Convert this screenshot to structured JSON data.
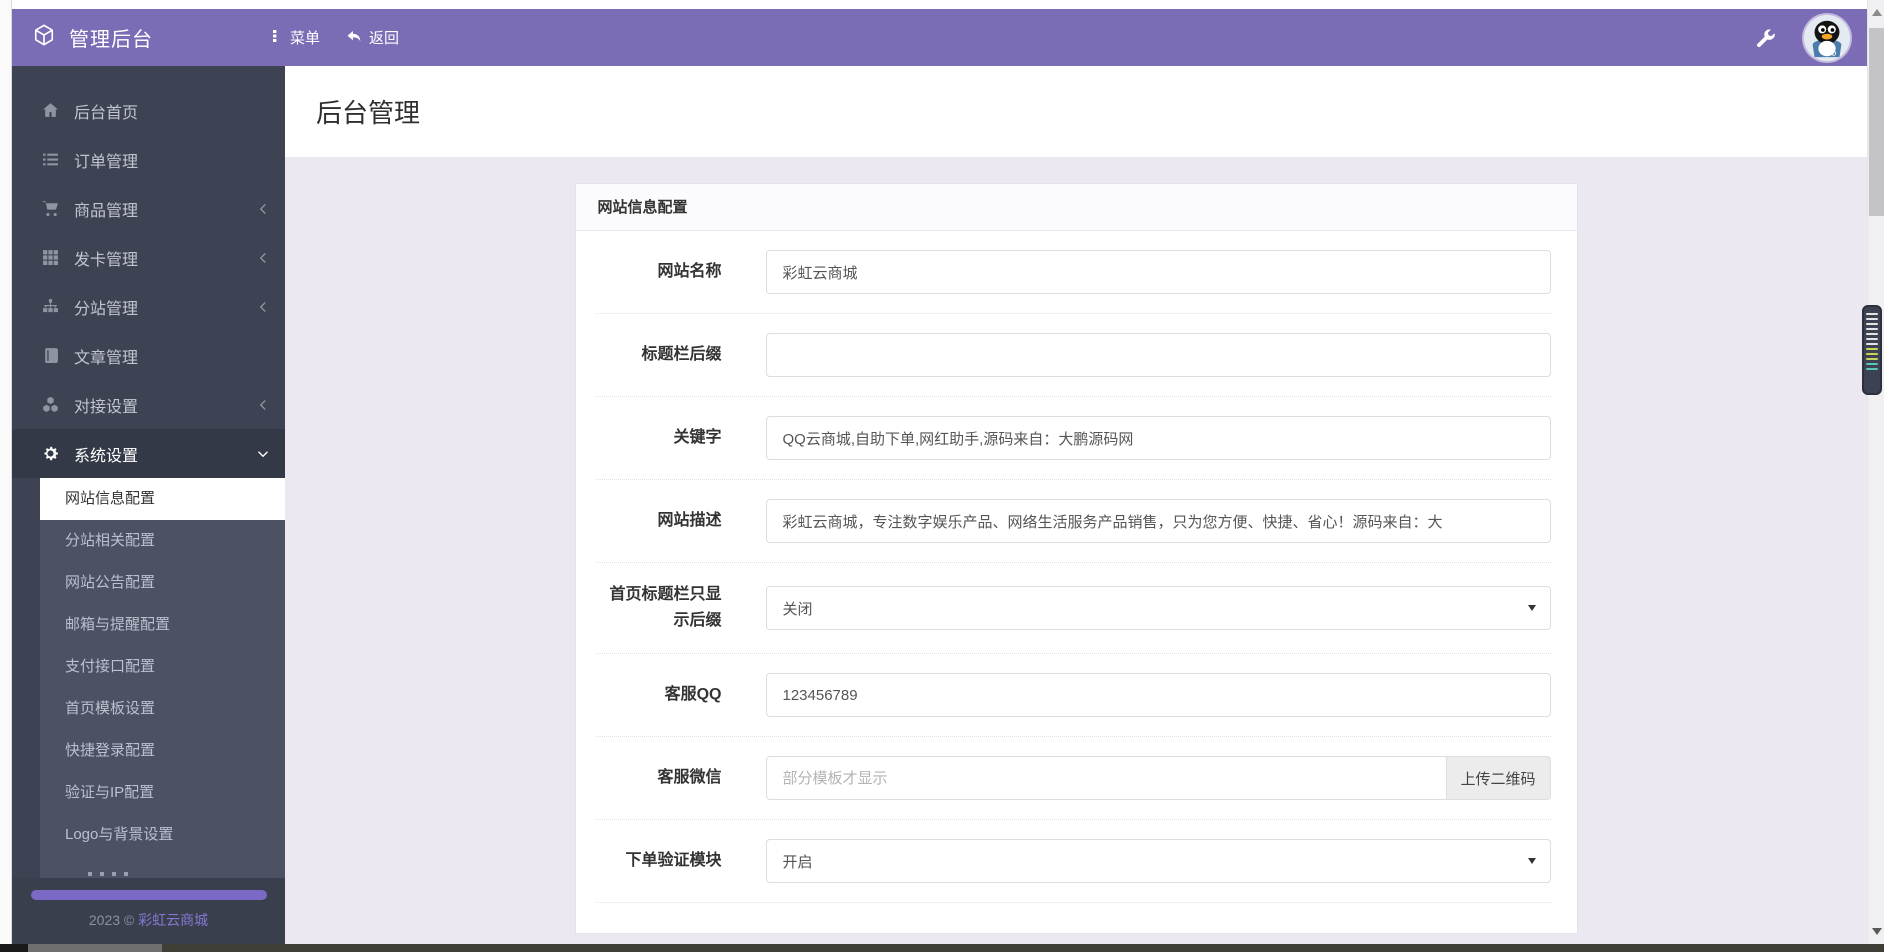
{
  "header": {
    "brand": "管理后台",
    "menu_label": "菜单",
    "back_label": "返回",
    "brand_icon": "cube-icon",
    "right_icons": [
      "wrench-icon",
      "qq-avatar"
    ]
  },
  "sidebar": {
    "items": [
      {
        "label": "后台首页",
        "icon": "home-icon",
        "chevron": null,
        "active": false
      },
      {
        "label": "订单管理",
        "icon": "list-icon",
        "chevron": null,
        "active": false
      },
      {
        "label": "商品管理",
        "icon": "cart-icon",
        "chevron": "left",
        "active": false
      },
      {
        "label": "发卡管理",
        "icon": "grid-icon",
        "chevron": "left",
        "active": false
      },
      {
        "label": "分站管理",
        "icon": "sitemap-icon",
        "chevron": "left",
        "active": false
      },
      {
        "label": "文章管理",
        "icon": "book-icon",
        "chevron": null,
        "active": false
      },
      {
        "label": "对接设置",
        "icon": "cubes-icon",
        "chevron": "left",
        "active": false
      },
      {
        "label": "系统设置",
        "icon": "gear-icon",
        "chevron": "down",
        "active": true
      }
    ],
    "submenu": [
      "网站信息配置",
      "分站相关配置",
      "网站公告配置",
      "邮箱与提醒配置",
      "支付接口配置",
      "首页模板设置",
      "快捷登录配置",
      "验证与IP配置",
      "Logo与背景设置"
    ],
    "submenu_active": "网站信息配置",
    "footer_year": "2023 © ",
    "footer_link": "彩虹云商城"
  },
  "page": {
    "title": "后台管理"
  },
  "panel": {
    "title": "网站信息配置",
    "rows": [
      {
        "label": "网站名称",
        "type": "input",
        "value": "彩虹云商城",
        "placeholder": ""
      },
      {
        "label": "标题栏后缀",
        "type": "input",
        "value": "",
        "placeholder": ""
      },
      {
        "label": "关键字",
        "type": "input",
        "value": "QQ云商城,自助下单,网红助手,源码来自：大鹏源码网",
        "placeholder": ""
      },
      {
        "label": "网站描述",
        "type": "input",
        "value": "彩虹云商城，专注数字娱乐产品、网络生活服务产品销售，只为您方便、快捷、省心！源码来自：大",
        "placeholder": ""
      },
      {
        "label": "首页标题栏只显示后缀",
        "type": "select",
        "value": "关闭"
      },
      {
        "label": "客服QQ",
        "type": "input",
        "value": "123456789",
        "placeholder": ""
      },
      {
        "label": "客服微信",
        "type": "input",
        "value": "",
        "placeholder": "部分模板才显示",
        "button": "上传二维码"
      },
      {
        "label": "下单验证模块",
        "type": "select",
        "value": "开启"
      }
    ]
  },
  "colors": {
    "accent_purple": "#7c6bb5",
    "sidebar_dark": "#3d4352",
    "submenu_gray": "#4c5164",
    "content_bg": "#ebe8f1",
    "footer_link_purple": "#8577d1",
    "pill_purple": "#7b6ac5"
  },
  "scroll_widget": {
    "stripe_colors": {
      "gray": "#e3e3e3",
      "yellow_green": "#c9d45f",
      "teal": "#55c8b7"
    },
    "stripe_counts": {
      "gray": 7,
      "yellow_green": 3,
      "teal": 2
    }
  }
}
